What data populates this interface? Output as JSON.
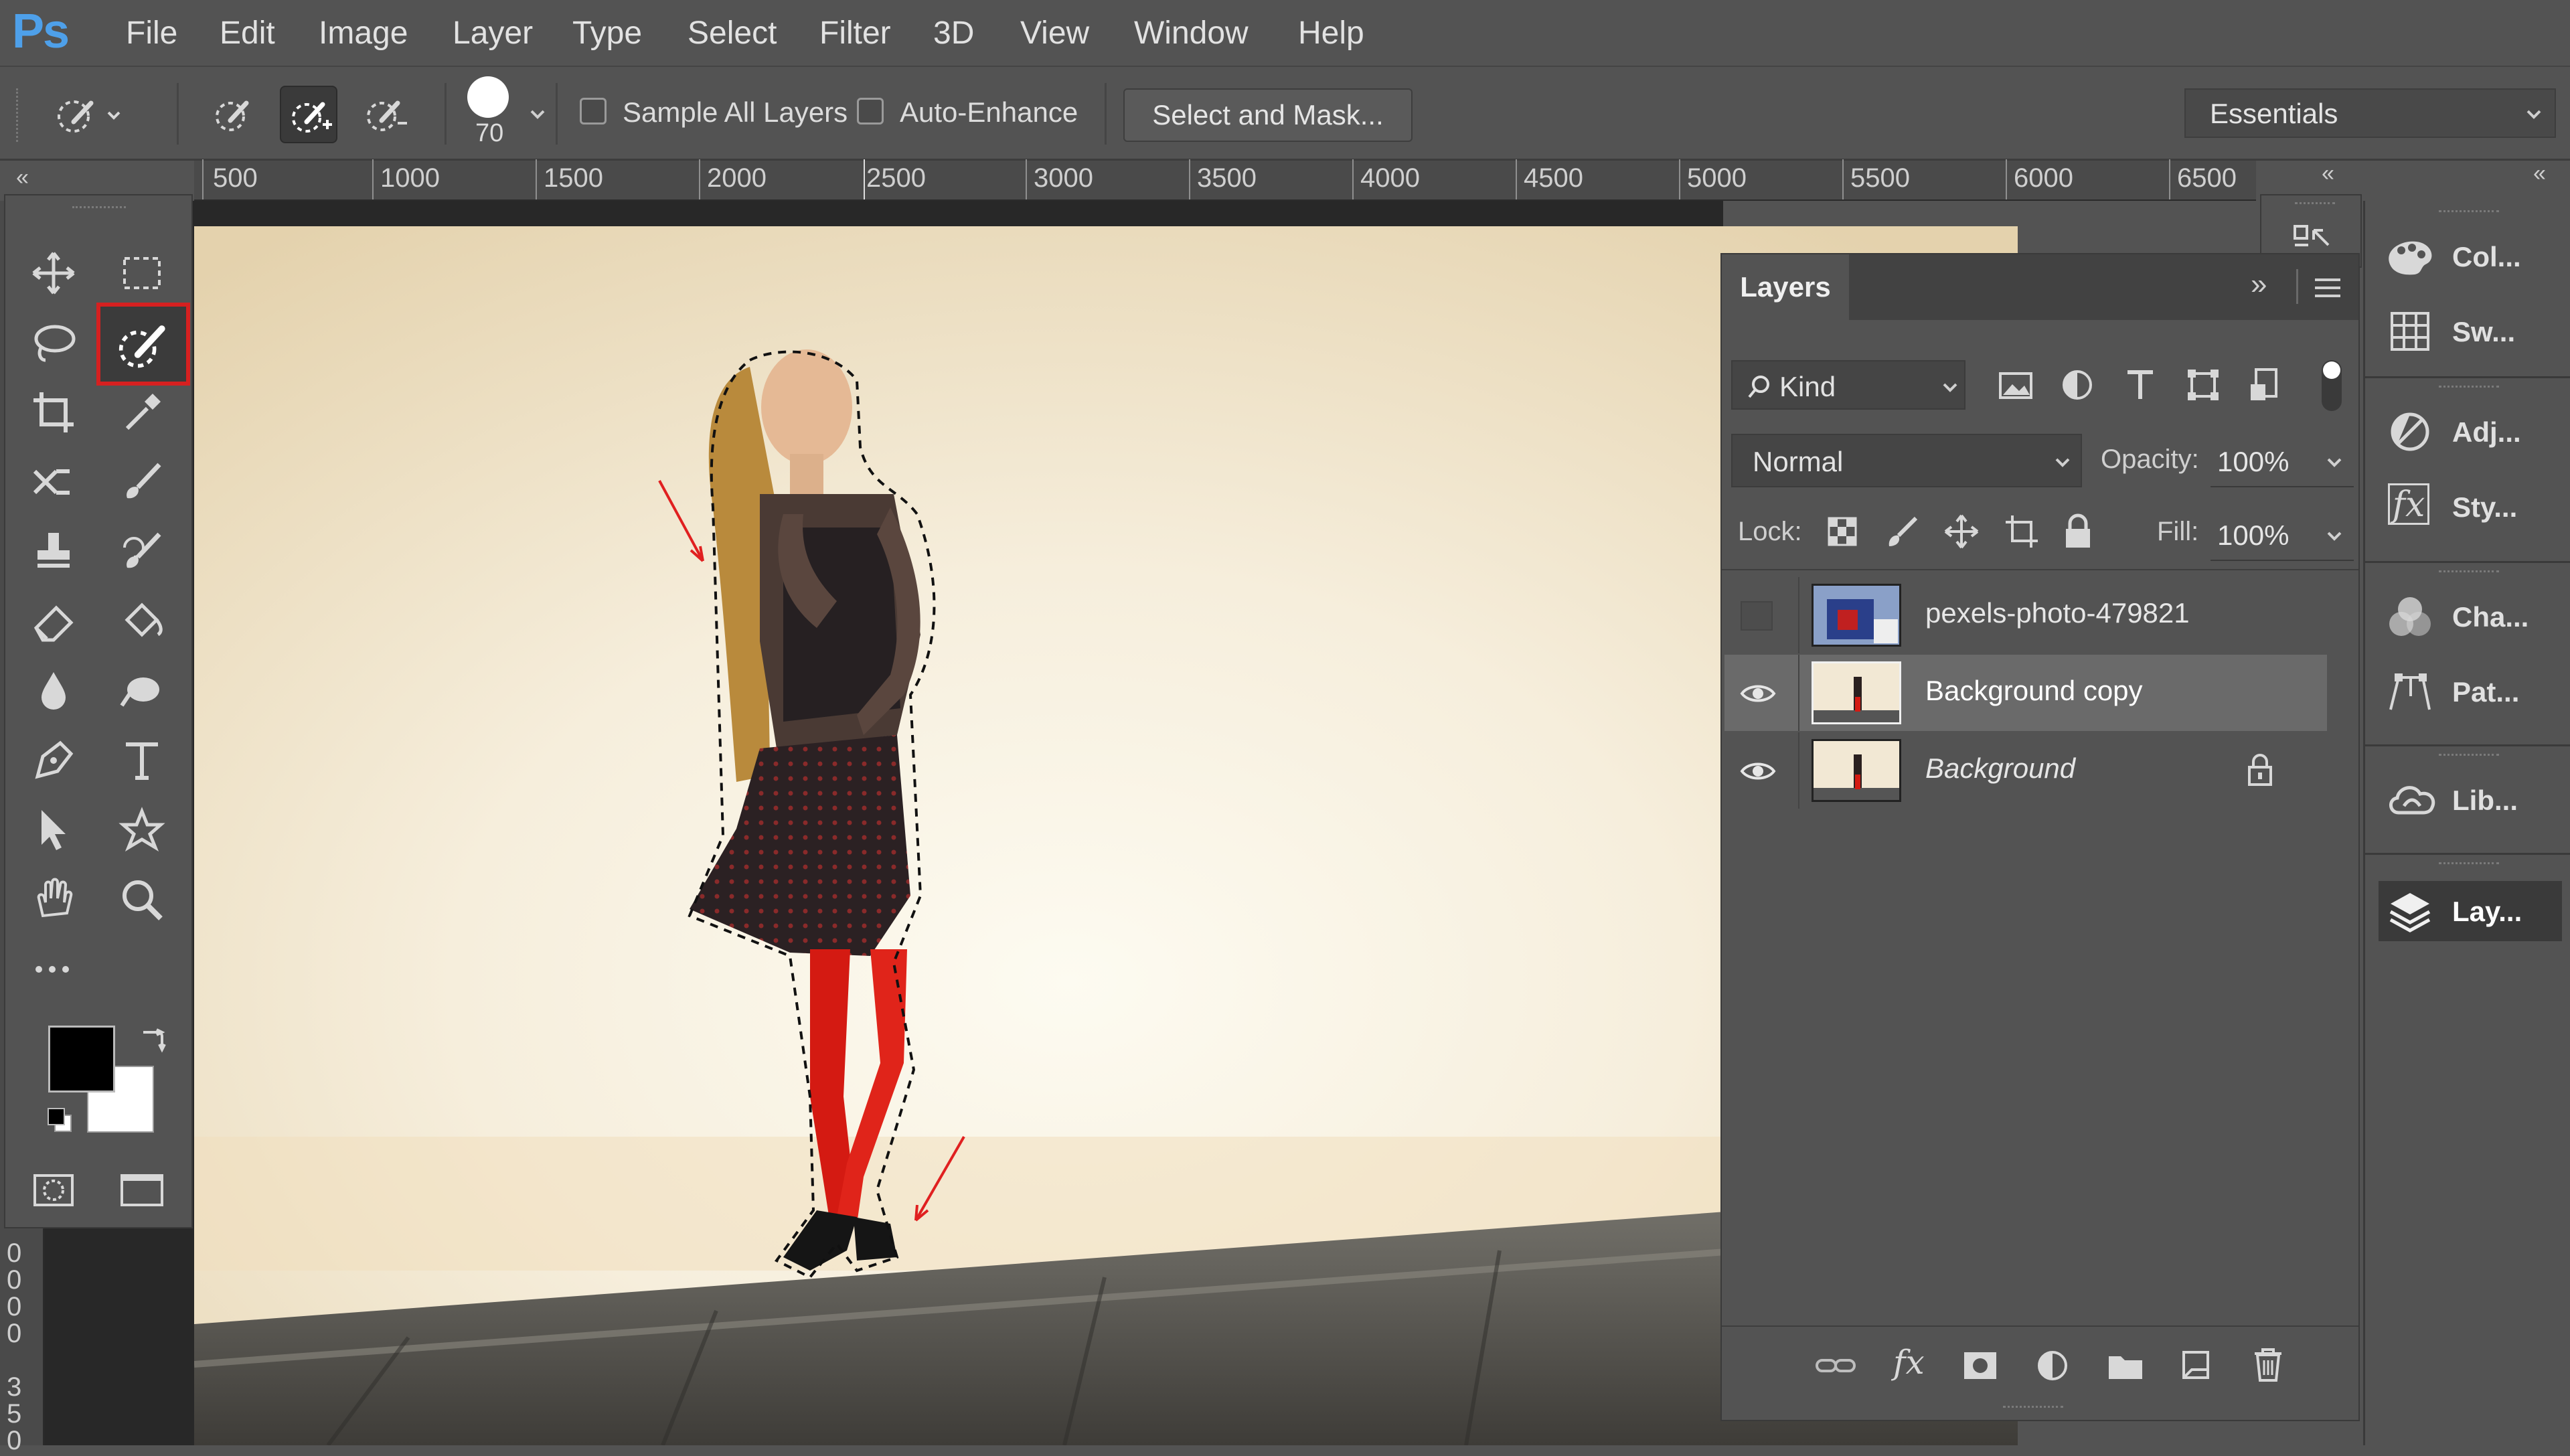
{
  "app": {
    "logo": "Ps"
  },
  "menu": [
    "File",
    "Edit",
    "Image",
    "Layer",
    "Type",
    "Select",
    "Filter",
    "3D",
    "View",
    "Window",
    "Help"
  ],
  "options": {
    "brush_size": "70",
    "sample_all_layers": "Sample All Layers",
    "auto_enhance": "Auto-Enhance",
    "select_and_mask": "Select and Mask...",
    "workspace": "Essentials"
  },
  "ruler": {
    "labels": [
      "500",
      "1000",
      "1500",
      "2000",
      "2500",
      "3000",
      "3500",
      "4000",
      "4500",
      "5000",
      "5500",
      "6000",
      "6500"
    ],
    "vertical_labels": [
      "0",
      "0",
      "0",
      "0",
      "3",
      "5",
      "0"
    ]
  },
  "layers_panel": {
    "tab": "Layers",
    "filter_kind": "Kind",
    "blend_mode": "Normal",
    "opacity_label": "Opacity:",
    "opacity_value": "100%",
    "lock_label": "Lock:",
    "fill_label": "Fill:",
    "fill_value": "100%",
    "layers": [
      {
        "name": "pexels-photo-479821",
        "visible": false,
        "selected": false,
        "locked": false
      },
      {
        "name": "Background copy",
        "visible": true,
        "selected": true,
        "locked": false
      },
      {
        "name": "Background",
        "visible": true,
        "selected": false,
        "locked": true
      }
    ]
  },
  "right_panels": [
    "Col...",
    "Sw...",
    "Adj...",
    "Sty...",
    "Cha...",
    "Pat...",
    "Lib...",
    "Lay..."
  ],
  "colors": {
    "foreground": "#000000",
    "background": "#ffffff",
    "highlight": "#d62020",
    "accent": "#4ea0ea"
  }
}
